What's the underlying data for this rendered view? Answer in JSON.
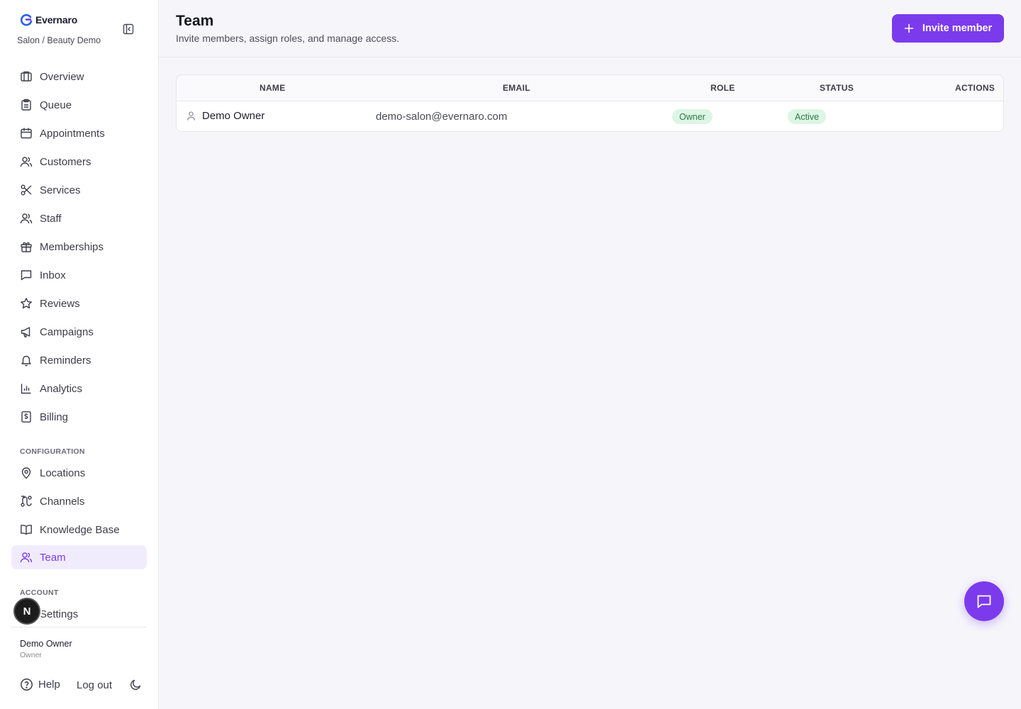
{
  "brand": {
    "name": "Evernaro",
    "subtitle": "Salon / Beauty Demo"
  },
  "nav": {
    "items": [
      {
        "label": "Overview",
        "icon": "building-icon"
      },
      {
        "label": "Queue",
        "icon": "clipboard-icon"
      },
      {
        "label": "Appointments",
        "icon": "calendar-icon"
      },
      {
        "label": "Customers",
        "icon": "users-icon"
      },
      {
        "label": "Services",
        "icon": "scissors-icon"
      },
      {
        "label": "Staff",
        "icon": "users-icon"
      },
      {
        "label": "Memberships",
        "icon": "gift-icon"
      },
      {
        "label": "Inbox",
        "icon": "message-icon"
      },
      {
        "label": "Reviews",
        "icon": "star-icon"
      },
      {
        "label": "Campaigns",
        "icon": "megaphone-icon"
      },
      {
        "label": "Reminders",
        "icon": "bell-icon"
      },
      {
        "label": "Analytics",
        "icon": "bar-chart-icon"
      },
      {
        "label": "Billing",
        "icon": "receipt-icon"
      }
    ],
    "configuration_label": "CONFIGURATION",
    "configuration": [
      {
        "label": "Locations",
        "icon": "map-pin-icon"
      },
      {
        "label": "Channels",
        "icon": "route-icon"
      },
      {
        "label": "Knowledge Base",
        "icon": "book-icon"
      },
      {
        "label": "Team",
        "icon": "users-icon",
        "active": true
      }
    ],
    "account_label": "ACCOUNT",
    "account": [
      {
        "label": "Settings",
        "icon": "gear-icon"
      }
    ]
  },
  "user": {
    "name": "Demo Owner",
    "role": "Owner",
    "badge_letter": "N"
  },
  "footer": {
    "help": "Help",
    "logout": "Log out"
  },
  "header": {
    "title": "Team",
    "subtitle": "Invite members, assign roles, and manage access.",
    "invite_label": "Invite member"
  },
  "table": {
    "columns": [
      "NAME",
      "EMAIL",
      "ROLE",
      "STATUS",
      "ACTIONS"
    ],
    "rows": [
      {
        "name": "Demo Owner",
        "email": "demo-salon@evernaro.com",
        "role": "Owner",
        "status": "Active"
      }
    ]
  },
  "colors": {
    "accent": "#7c3aed",
    "active_bg": "#f1ecfd",
    "badge_bg": "#dcf5e4",
    "badge_text": "#2c7a47"
  }
}
